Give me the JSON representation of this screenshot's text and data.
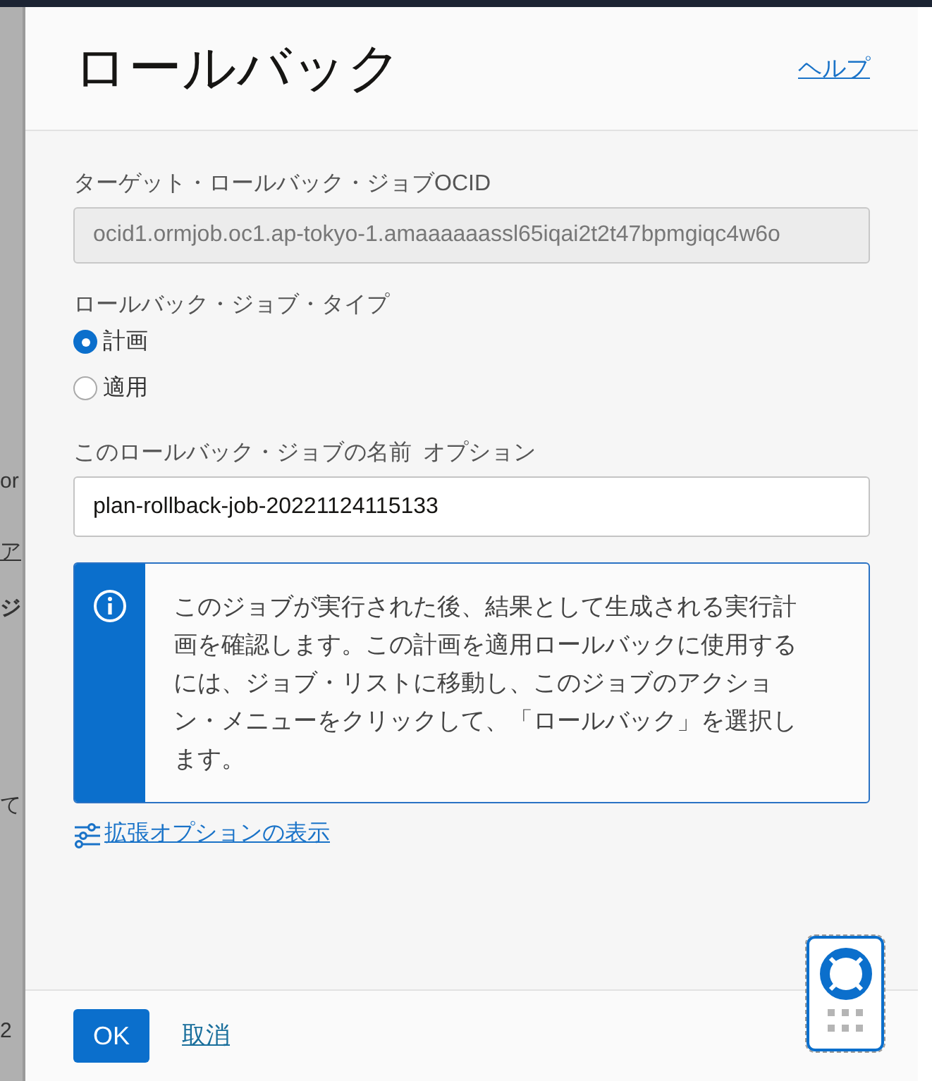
{
  "background_fragments": [
    "or",
    "ア",
    "ジ",
    "て",
    "2"
  ],
  "dialog": {
    "title": "ロールバック",
    "help_link": "ヘルプ"
  },
  "target_ocid": {
    "label": "ターゲット・ロールバック・ジョブOCID",
    "value": "ocid1.ormjob.oc1.ap-tokyo-1.amaaaaaassl65iqai2t2t47bpmgiqc4w6o",
    "disabled": true
  },
  "job_type": {
    "label": "ロールバック・ジョブ・タイプ",
    "options": [
      {
        "label": "計画",
        "selected": true
      },
      {
        "label": "適用",
        "selected": false
      }
    ]
  },
  "job_name": {
    "label": "このロールバック・ジョブの名前",
    "optional": "オプション",
    "value": "plan-rollback-job-20221124115133"
  },
  "info_box": {
    "text": "このジョブが実行された後、結果として生成される実行計画を確認します。この計画を適用ロールバックに使用するには、ジョブ・リストに移動し、このジョブのアクション・メニューをクリックして、「ロールバック」を選択します。"
  },
  "advanced_link": "拡張オプションの表示",
  "buttons": {
    "ok": "OK",
    "cancel": "取消"
  }
}
